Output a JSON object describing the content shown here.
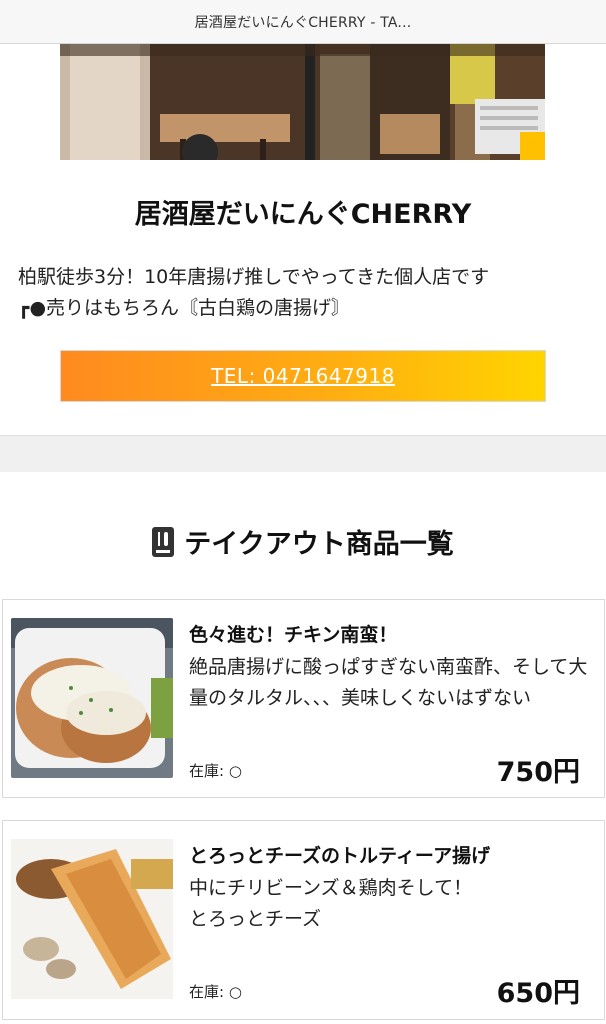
{
  "browser": {
    "tab_title": "居酒屋だいにんぐCHERRY - TA..."
  },
  "shop": {
    "name": "居酒屋だいにんぐCHERRY",
    "description_line1": "柏駅徒歩3分！10年唐揚げ推しでやってきた個人店です",
    "description_line2": "┏●売りはもちろん〘古白鶏の唐揚げ〙",
    "tel_label": "TEL: 0471647918"
  },
  "takeout": {
    "title": "テイクアウト商品一覧",
    "title_icon": "menu-book-icon",
    "items": [
      {
        "name": "色々進む！チキン南蛮！",
        "description": "絶品唐揚げに酸っぱすぎない南蛮酢、そして大量のタルタル、、、美味しくないはずない",
        "stock": "在庫: ○",
        "price": "750円"
      },
      {
        "name": "とろっとチーズのトルティーア揚げ",
        "description_line1": "中にチリビーンズ＆鶏肉そして！",
        "description_line2": "とろっとチーズ",
        "stock": "在庫: ○",
        "price": "650円"
      }
    ]
  },
  "colors": {
    "tel_gradient_start": "#ff8a1f",
    "tel_gradient_end": "#ffd400"
  }
}
